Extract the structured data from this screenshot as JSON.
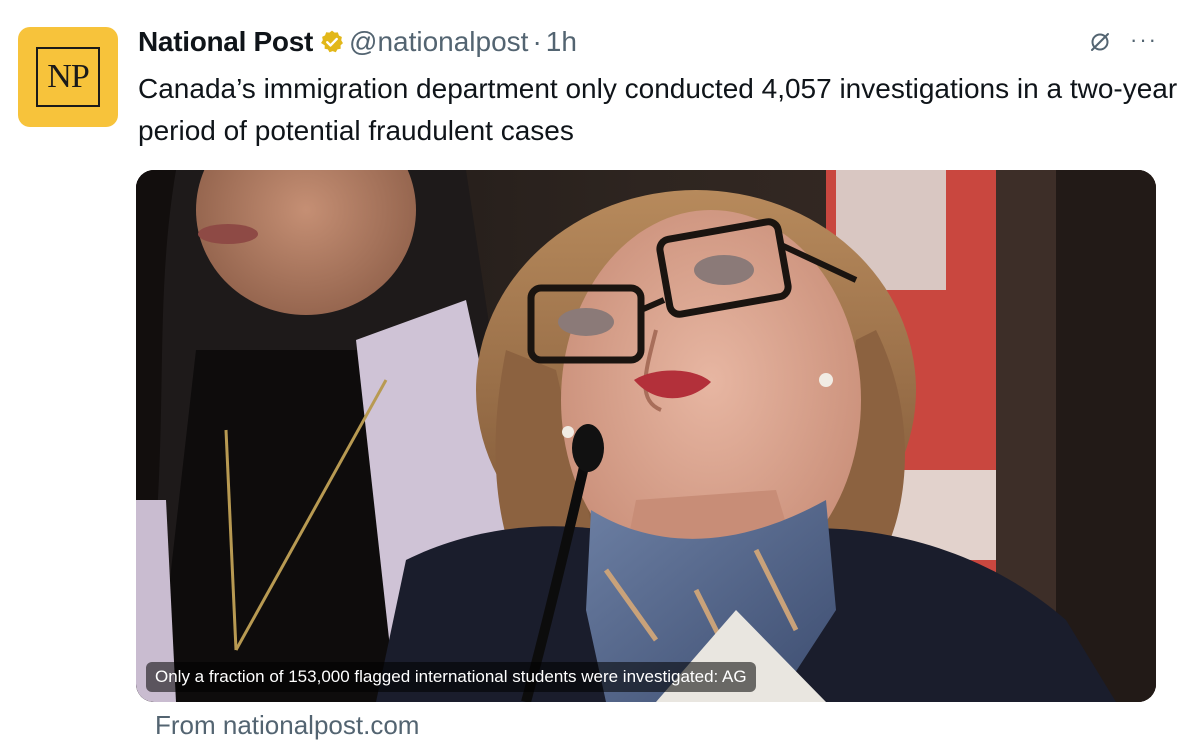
{
  "tweet": {
    "author_name": "National Post",
    "handle": "@nationalpost",
    "separator": "·",
    "time": "1h",
    "avatar_text": "NP",
    "verified_icon": "gold-verified-badge-icon",
    "text": "Canada’s immigration department only conducted 4,057 investigations in a two-year period of potential fraudulent cases"
  },
  "actions": {
    "grok_icon": "grok-icon",
    "more_label": "···"
  },
  "card": {
    "image_alt": "Woman with glasses speaking at microphone in front of Canadian flag",
    "caption": "Only a fraction of 153,000 flagged international students were investigated: AG",
    "source": "From nationalpost.com"
  },
  "colors": {
    "avatar_bg": "#f7c33b",
    "verified_gold": "#e2b719",
    "secondary_text": "#536471",
    "primary_text": "#0f1419"
  }
}
